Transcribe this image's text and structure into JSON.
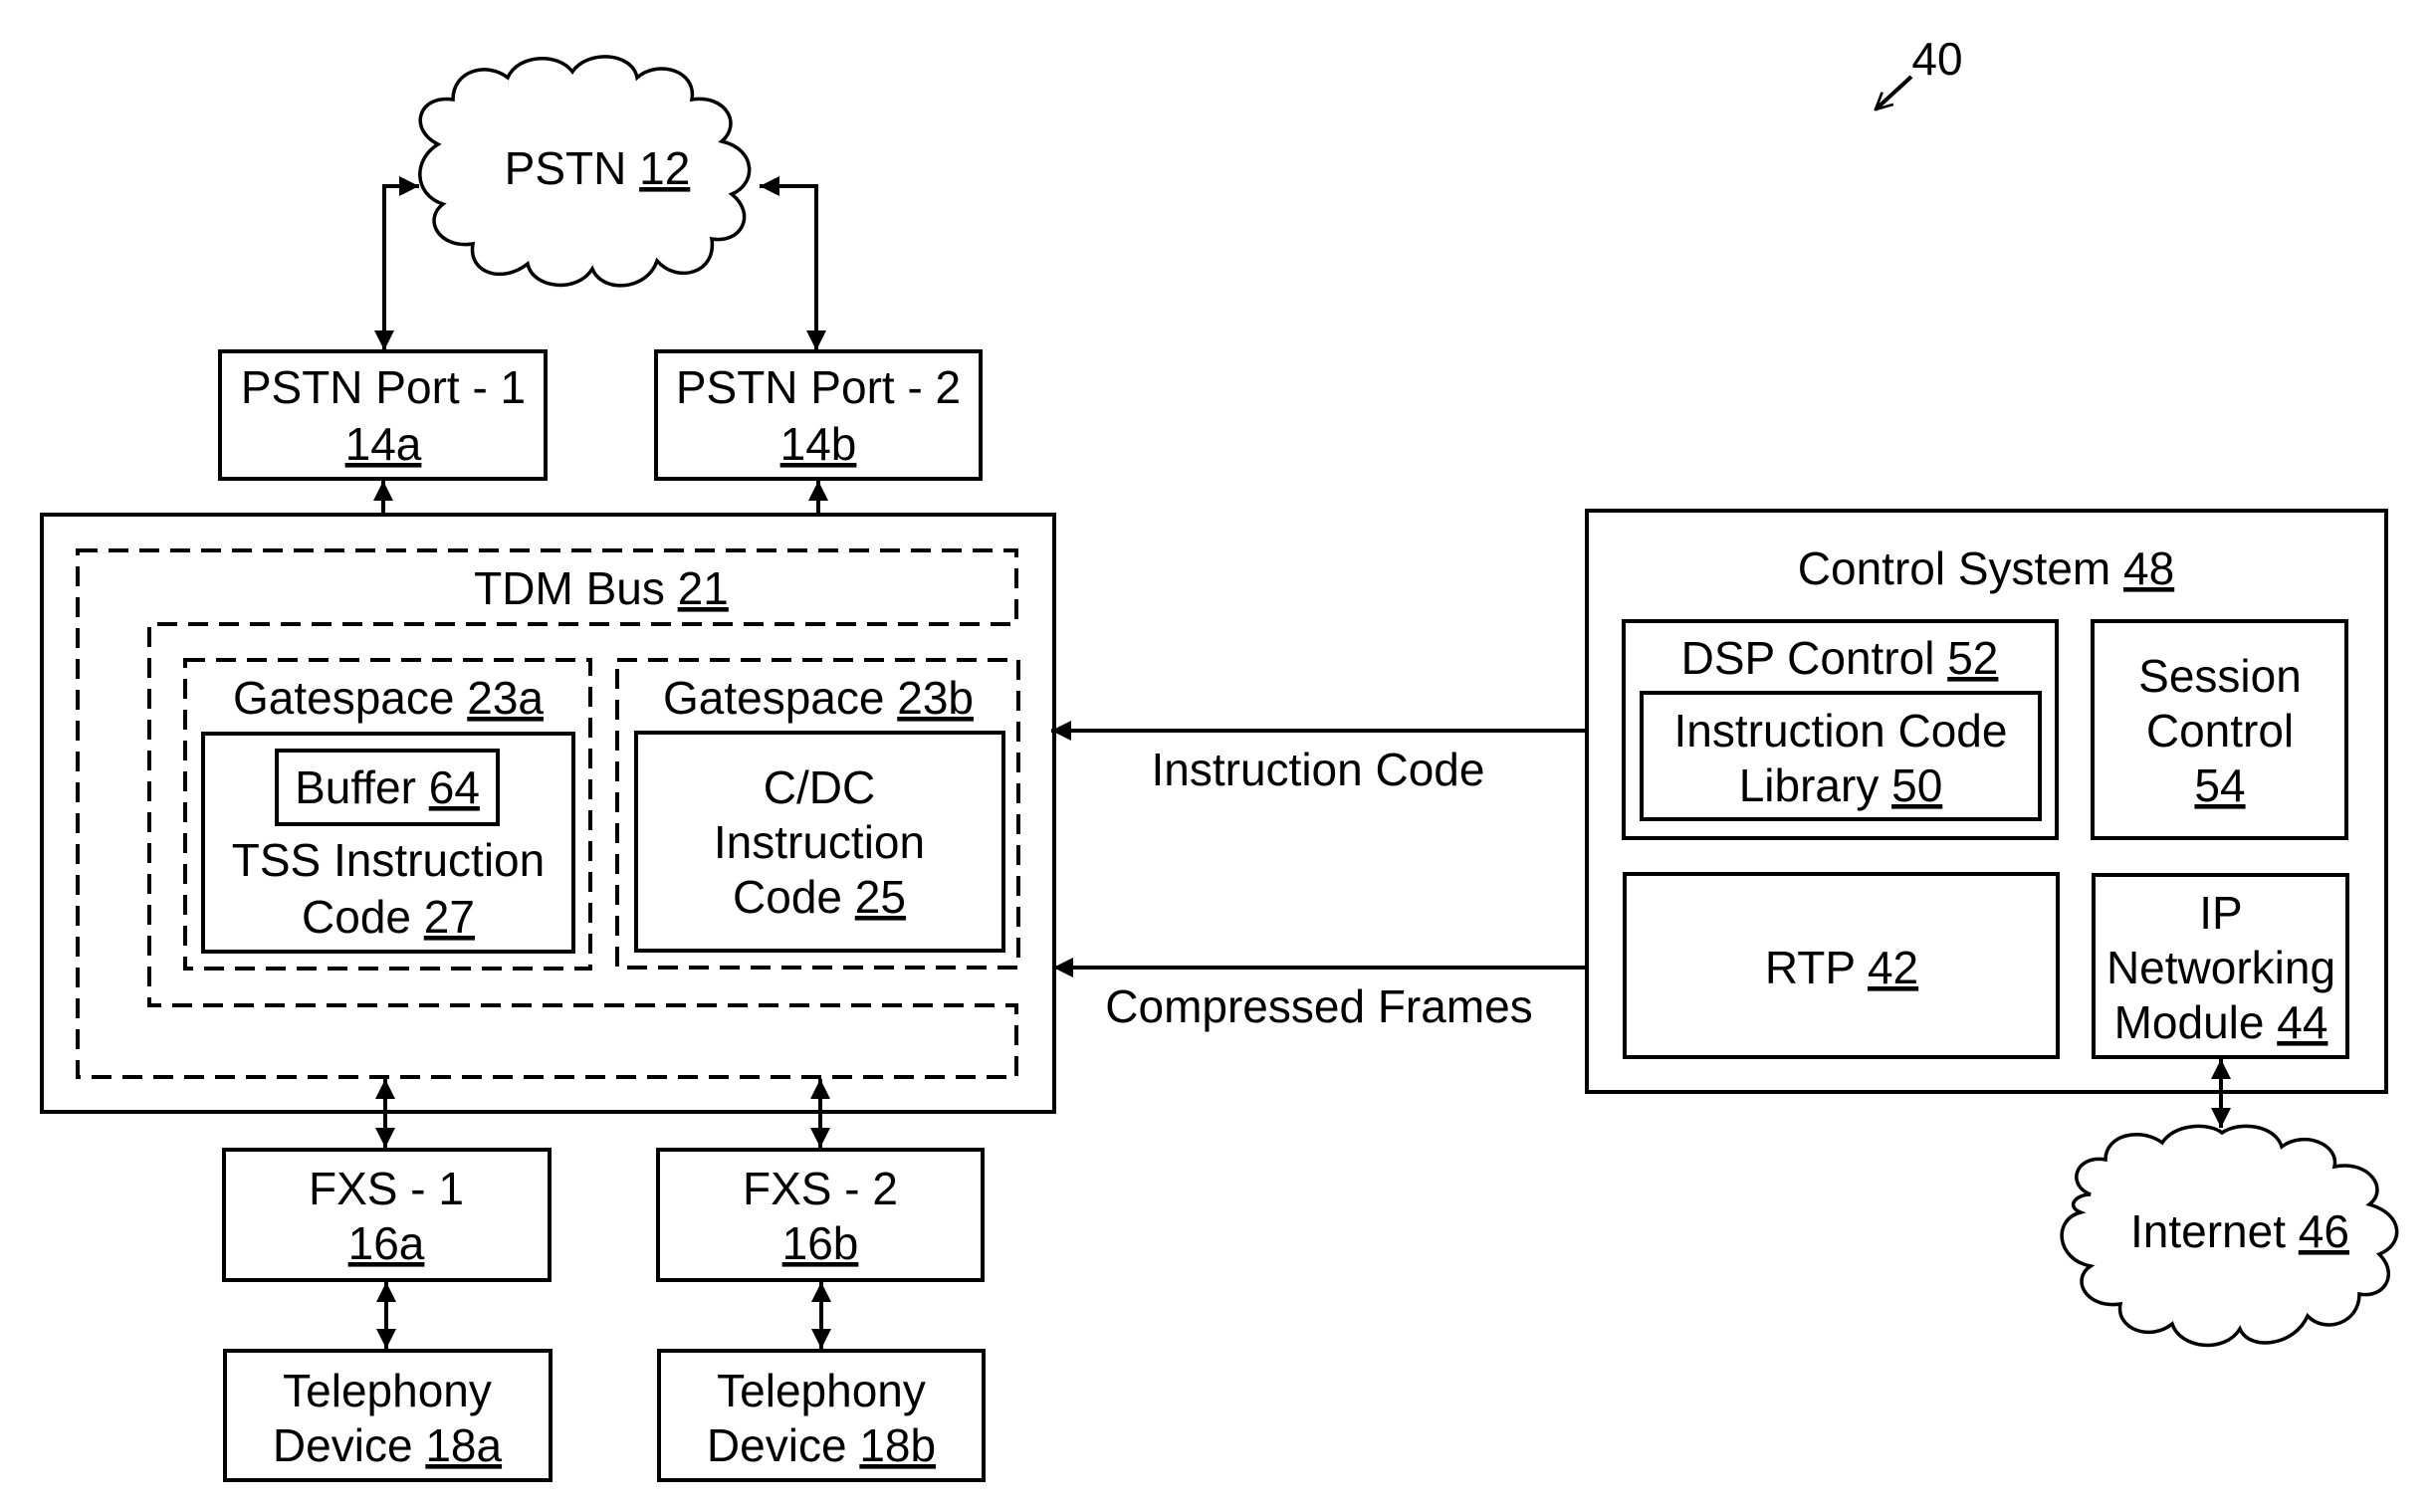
{
  "figure": {
    "ref_number": "40",
    "nodes": {
      "pstn": {
        "lines": [
          {
            "text": "PSTN",
            "ref": "12"
          }
        ]
      },
      "pstn_port_1": {
        "lines": [
          {
            "text": "PSTN Port - 1",
            "ref": ""
          },
          {
            "text": "",
            "ref": "14a"
          }
        ]
      },
      "pstn_port_2": {
        "lines": [
          {
            "text": "PSTN Port - 2",
            "ref": ""
          },
          {
            "text": "",
            "ref": "14b"
          }
        ]
      },
      "tdm_bus": {
        "lines": [
          {
            "text": "TDM Bus",
            "ref": "21"
          }
        ]
      },
      "gatespace_a": {
        "lines": [
          {
            "text": "Gatespace",
            "ref": "23a"
          }
        ]
      },
      "gatespace_b": {
        "lines": [
          {
            "text": "Gatespace",
            "ref": "23b"
          }
        ]
      },
      "buffer": {
        "lines": [
          {
            "text": "Buffer",
            "ref": "64"
          }
        ]
      },
      "tss_code": {
        "lines": [
          {
            "text": "TSS Instruction",
            "ref": ""
          },
          {
            "text": "Code",
            "ref": "27"
          }
        ]
      },
      "cdc_code": {
        "lines": [
          {
            "text": "C/DC",
            "ref": ""
          },
          {
            "text": "Instruction",
            "ref": ""
          },
          {
            "text": "Code",
            "ref": "25"
          }
        ]
      },
      "fxs_1": {
        "lines": [
          {
            "text": "FXS - 1",
            "ref": ""
          },
          {
            "text": "",
            "ref": "16a"
          }
        ]
      },
      "fxs_2": {
        "lines": [
          {
            "text": "FXS - 2",
            "ref": ""
          },
          {
            "text": "",
            "ref": "16b"
          }
        ]
      },
      "telephony_a": {
        "lines": [
          {
            "text": "Telephony",
            "ref": ""
          },
          {
            "text": "Device",
            "ref": "18a"
          }
        ]
      },
      "telephony_b": {
        "lines": [
          {
            "text": "Telephony",
            "ref": ""
          },
          {
            "text": "Device",
            "ref": "18b"
          }
        ]
      },
      "control_system": {
        "lines": [
          {
            "text": "Control System",
            "ref": "48"
          }
        ]
      },
      "dsp_control": {
        "lines": [
          {
            "text": "DSP Control",
            "ref": "52"
          }
        ]
      },
      "instruction_library": {
        "lines": [
          {
            "text": "Instruction Code",
            "ref": ""
          },
          {
            "text": "Library",
            "ref": "50"
          }
        ]
      },
      "session_control": {
        "lines": [
          {
            "text": "Session",
            "ref": ""
          },
          {
            "text": "Control",
            "ref": ""
          },
          {
            "text": "",
            "ref": "54"
          }
        ]
      },
      "rtp": {
        "lines": [
          {
            "text": "RTP",
            "ref": "42"
          }
        ]
      },
      "ip_networking": {
        "lines": [
          {
            "text": "IP",
            "ref": ""
          },
          {
            "text": "Networking",
            "ref": ""
          },
          {
            "text": "Module",
            "ref": "44"
          }
        ]
      },
      "internet": {
        "lines": [
          {
            "text": "Internet",
            "ref": "46"
          }
        ]
      }
    },
    "connections": {
      "instruction_code": "Instruction Code",
      "compressed_frames": "Compressed Frames"
    }
  }
}
